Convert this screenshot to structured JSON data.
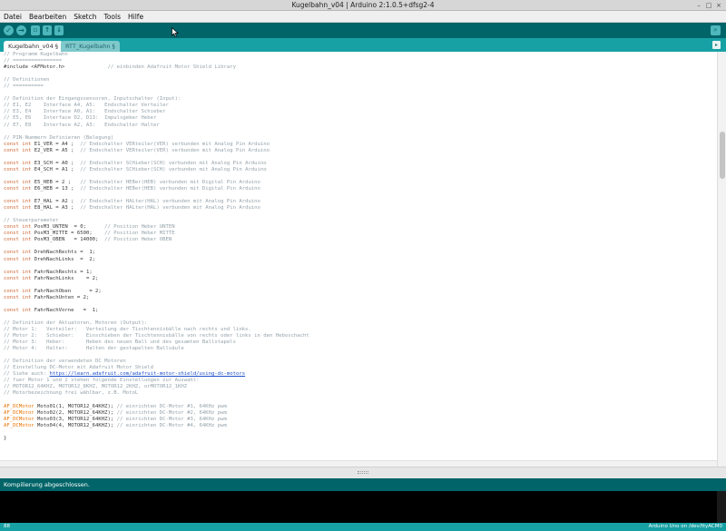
{
  "window": {
    "title": "Kugelbahn_v04 | Arduino 2:1.0.5+dfsg2-4",
    "buttons": [
      "–",
      "□",
      "×"
    ]
  },
  "menu": [
    "Datei",
    "Bearbeiten",
    "Sketch",
    "Tools",
    "Hilfe"
  ],
  "toolbar": {
    "buttons": [
      {
        "name": "verify-icon",
        "glyph": "✓"
      },
      {
        "name": "upload-icon",
        "glyph": "→"
      },
      {
        "name": "new-icon",
        "glyph": "▫"
      },
      {
        "name": "open-icon",
        "glyph": "↑"
      },
      {
        "name": "save-icon",
        "glyph": "↓"
      }
    ],
    "serial_monitor_glyph": "⌕"
  },
  "tabs": [
    {
      "label": "Kugelbahn_v04 §",
      "active": true
    },
    {
      "label": "RTT_Kugelbahn §",
      "active": false
    }
  ],
  "tab_menu_glyph": "▸",
  "colors": {
    "toolbar": "#006468",
    "tabbar": "#17a1a5",
    "comment": "#95a3ab",
    "keyword": "#cc6633",
    "type": "#e97200",
    "link": "#1f50c8"
  },
  "code_lines": [
    "// Programm Kugelbahn",
    "// ================",
    "#include <AFMotor.h>              // einbinden Adafruit Motor Shield Library",
    "",
    "// Definitionen",
    "// ==========",
    "",
    "// Definition der Eingangssensoren, Inputschalter (Input):",
    "// E1, E2    Interface A4, A5:   Endschalter Verteiler",
    "// E3, E4    Interface A0, A1:   Endschalter Schieber",
    "// E5, E6    Interface D2, D13:  Impulsgeber Heber",
    "// E7, E8    Interface A2, A3:   Endschalter Halter",
    "",
    "// PIN-Nummern Definieren (Belegung)",
    "const int E1_VER = A4 ;  // Endschalter VERteiler(VER) verbunden mit Analog Pin Arduino",
    "const int E2_VER = A5 ;  // Endschalter VERteiler(VER) verbunden mit Analog Pin Arduino",
    "",
    "const int E3_SCH = A0 ;  // Endschalter SCHieber(SCH) verbunden mit Analog Pin Arduino",
    "const int E4_SCH = A1 ;  // Endschalter SCHieber(SCH) verbunden mit Analog Pin Arduino",
    "",
    "const int E5_HEB = 2 ;   // Endschalter HEBer(HEB) verbunden mit Digital Pin Arduino",
    "const int E6_HEB = 13 ;  // Endschalter HEBer(HEB) verbunden mit Digital Pin Arduino",
    "",
    "const int E7_HAL = A2 ;  // Endschalter HALter(HAL) verbunden mit Analog Pin Arduino",
    "const int E8_HAL = A3 ;  // Endschalter HALter(HAL) verbunden mit Analog Pin Arduino",
    "",
    "// Steuerparameter",
    "const int PosM3_UNTEN  = 0;      // Position Heber UNTEN",
    "const int PosM3_MITTE = 6500;    // Position Heber MITTE",
    "const int PosM3_OBEN   = 14000;  // Position Heber OBEN",
    "",
    "const int DrehNachRechts =  1;",
    "const int DrehNachLinks  =  2;",
    "",
    "const int FahrNachRechts = 1;",
    "const int FahrNachLinks    = 2;",
    "",
    "const int FahrNachOben      = 2;",
    "const int FahrNachUnten = 2;",
    "",
    "const int FahrNachVorne   =  1;",
    "",
    "// Definition der Aktuatoren, Motoren (Output):",
    "// Motor 1:   Verteiler:   Verteilung der Tischtennisbälle nach rechts und links.",
    "// Motor 2:   Schieber:    Einschieben der Tischtennisbälle von rechts oder links in den Heboschacht",
    "// Motor 3:   Heber:       Heben des neuen Ball und des gesamten Ballstapels",
    "// Motor 4:   Halter:      Halten der gestapelten Ballsäule",
    "",
    "// Definition der verwendeten DC Motoren",
    "// Einstellung DC-Motor mit Adafruit Motor Shield",
    "// Siehe auch: https://learn.adafruit.com/adafruit-motor-shield/using-dc-motors",
    "// fuer Motor 1 und 2 stehen folgende Einstellungen zur Auswahl:",
    "// MOTOR12_64KHZ, MOTOR12_8KHZ, MOTOR12_2KHZ, orMOTOR12_1KHZ",
    "// Motorbezeichnung frei wählbar, z.B. MotoL",
    "",
    "AF_DCMotor Moto01(1, MOTOR12_64KHZ); // einrichten DC-Motor #1, 64KHz pwm",
    "AF_DCMotor Moto02(2, MOTOR12_64KHZ); // einrichten DC-Motor #2, 64KHz pwm",
    "AF_DCMotor Moto03(3, MOTOR12_64KHZ); // einrichten DC-Motor #3, 64KHz pwm",
    "AF_DCMotor Moto04(4, MOTOR12_64KHZ); // einrichten DC-Motor #4, 64KHz pwm",
    "",
    "}"
  ],
  "status_message": "Kompilierung abgeschlossen.",
  "footer": {
    "line": "88",
    "board": "Arduino Uno on /dev/ttyACM0"
  }
}
